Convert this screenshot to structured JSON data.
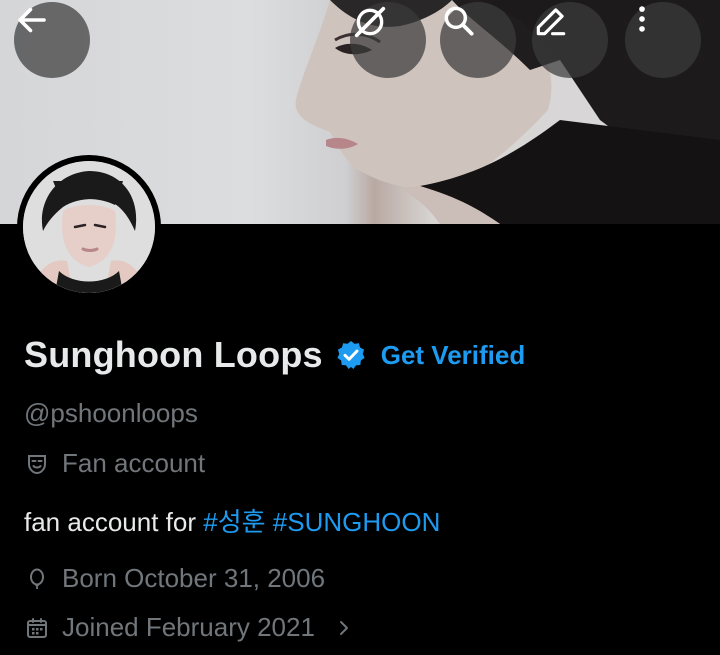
{
  "profile": {
    "display_name": "Sunghoon Loops",
    "get_verified_label": "Get Verified",
    "handle": "@pshoonloops",
    "category": "Fan account",
    "bio_text": "fan account for",
    "bio_hashtags": [
      "#성훈",
      "#SUNGHOON"
    ],
    "birthdate": "Born October 31, 2006",
    "joined": "Joined February 2021"
  },
  "icons": {
    "back": "back-arrow-icon",
    "link": "link-off-icon",
    "search": "search-icon",
    "edit": "edit-icon",
    "more": "more-vertical-icon",
    "verified": "verified-badge-icon",
    "category": "theater-masks-icon",
    "birthday": "balloon-icon",
    "calendar": "calendar-icon",
    "chevron": "chevron-right-icon"
  },
  "colors": {
    "background": "#000000",
    "accent": "#1d9bf0",
    "text_primary": "#e7e9ea",
    "text_secondary": "#71767b"
  }
}
